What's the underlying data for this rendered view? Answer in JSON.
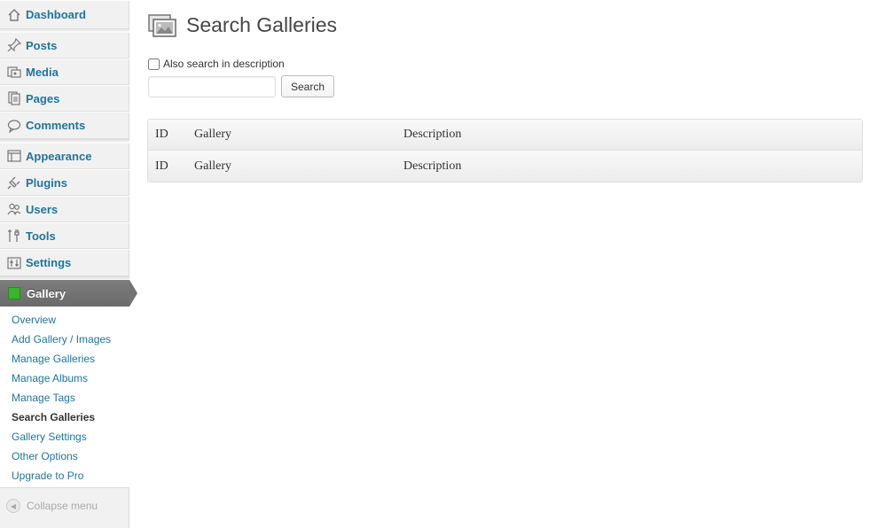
{
  "sidebar": {
    "items": [
      {
        "label": "Dashboard",
        "icon": "dashboard-icon"
      },
      {
        "label": "Posts",
        "icon": "pin-icon"
      },
      {
        "label": "Media",
        "icon": "media-icon"
      },
      {
        "label": "Pages",
        "icon": "pages-icon"
      },
      {
        "label": "Comments",
        "icon": "comment-icon"
      },
      {
        "label": "Appearance",
        "icon": "appearance-icon"
      },
      {
        "label": "Plugins",
        "icon": "plug-icon"
      },
      {
        "label": "Users",
        "icon": "users-icon"
      },
      {
        "label": "Tools",
        "icon": "tools-icon"
      },
      {
        "label": "Settings",
        "icon": "settings-icon"
      }
    ],
    "gallery": {
      "label": "Gallery",
      "icon": "gallery-icon",
      "accent": "#3ab32d"
    },
    "submenu": [
      "Overview",
      "Add Gallery / Images",
      "Manage Galleries",
      "Manage Albums",
      "Manage Tags",
      "Search Galleries",
      "Gallery Settings",
      "Other Options",
      "Upgrade to Pro"
    ],
    "collapse_label": "Collapse menu"
  },
  "main": {
    "title": "Search Galleries",
    "checkbox_label": "Also search in description",
    "search_value": "",
    "search_button": "Search",
    "table": {
      "columns": [
        "ID",
        "Gallery",
        "Description"
      ],
      "footer": [
        "ID",
        "Gallery",
        "Description"
      ]
    }
  },
  "colors": {
    "link": "#21759b",
    "sidebar_bg": "#f1f1f1",
    "active_menu": "#737373"
  }
}
